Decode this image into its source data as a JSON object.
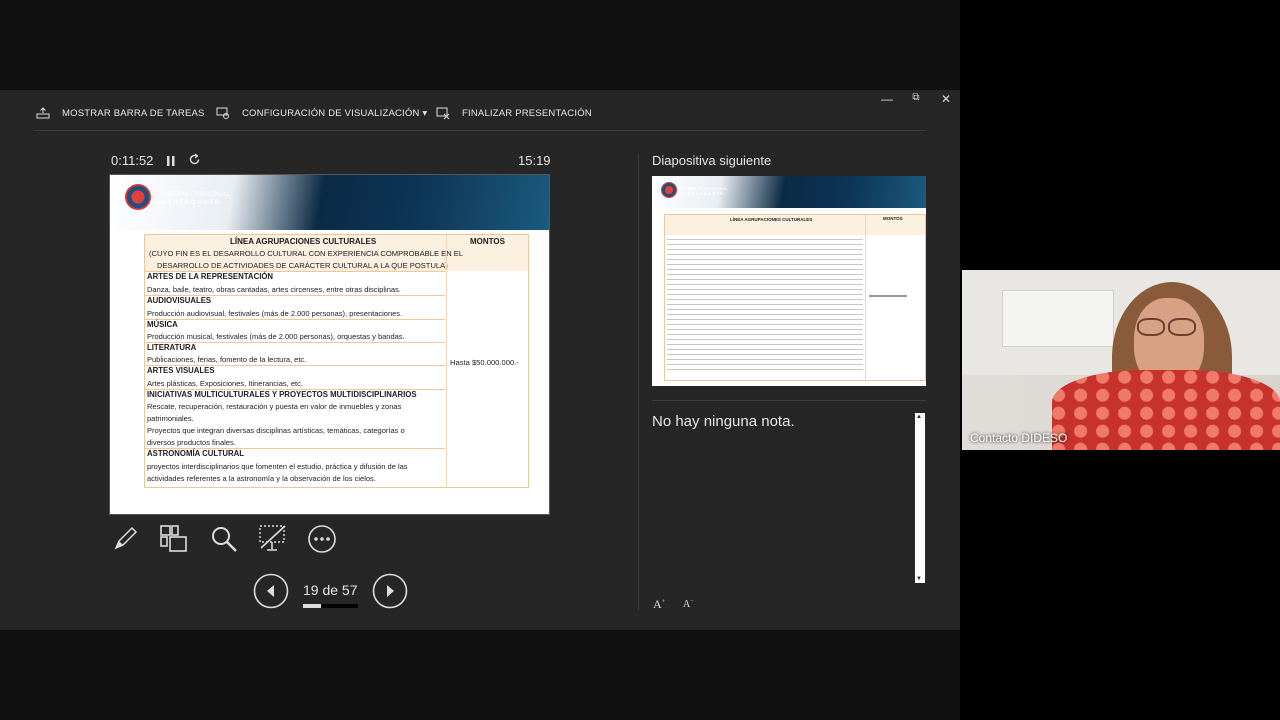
{
  "toolbar": {
    "show_taskbar": "MOSTRAR BARRA DE TAREAS",
    "display_settings": "CONFIGURACIÓN DE VISUALIZACIÓN ▾",
    "end_show": "FINALIZAR PRESENTACIÓN",
    "minimize": "—",
    "restore": "⧉",
    "close": "✕"
  },
  "timer": {
    "elapsed": "0:11:52",
    "clock": "15:19"
  },
  "slide": {
    "logo_line1": "GOBIERNO REGIONAL",
    "logo_line2": "ANTOFAGASTA",
    "table_title": "LÍNEA AGRUPACIONES CULTURALES",
    "table_subtitle_1": "(CUYO FIN ES EL DESARROLLO CULTURAL CON EXPERIENCIA COMPROBABLE EN EL",
    "table_subtitle_2": "DESARROLLO DE ACTIVIDADES DE CARÁCTER CULTURAL A LA QUE POSTULA)",
    "amount_header": "MONTOS",
    "amount_value": "Hasta $50.000.000.-",
    "sections": [
      {
        "head": "ARTES DE LA REPRESENTACIÓN",
        "body": [
          "Danza, baile, teatro, obras cantadas, artes circenses, entre otras disciplinas."
        ]
      },
      {
        "head": "AUDIOVISUALES",
        "body": [
          "Producción audiovisual, festivales (más de 2.000 personas), presentaciones."
        ]
      },
      {
        "head": "MÚSICA",
        "body": [
          "Producción musical, festivales (más de 2.000 personas), orquestas y bandas."
        ]
      },
      {
        "head": "LITERATURA",
        "body": [
          "Publicaciones, ferias, fomento de la lectura, etc."
        ]
      },
      {
        "head": "ARTES VISUALES",
        "body": [
          "Artes plásticas, Exposiciones, Itinerancias, etc."
        ]
      },
      {
        "head": "INICIATIVAS MULTICULTURALES Y PROYECTOS MULTIDISCIPLINARIOS",
        "body": [
          "Rescate, recuperación, restauración y puesta en valor de inmuebles y zonas",
          "patrimoniales.",
          "Proyectos que integran diversas disciplinas artísticas, temáticas, categorías o",
          "diversos productos finales."
        ]
      },
      {
        "head": "ASTRONOMÍA CULTURAL",
        "body": [
          "proyectos interdisciplinarios que fomenten el estudio, práctica y difusión de las",
          "actividades referentes a la astronomía y la observación de los cielos."
        ]
      }
    ]
  },
  "navigation": {
    "counter": "19 de 57",
    "progress": 0.33
  },
  "next_slide": {
    "label": "Diapositiva siguiente",
    "logo_line1": "GOBIERNO REGIONAL",
    "logo_line2": "ANTOFAGASTA",
    "title": "LÍNEA AGRUPACIONES CULTURALES",
    "amount_header": "MONTOS"
  },
  "notes": {
    "text": "No hay ninguna nota."
  },
  "webcam": {
    "name": "Contacto DIDESO"
  }
}
